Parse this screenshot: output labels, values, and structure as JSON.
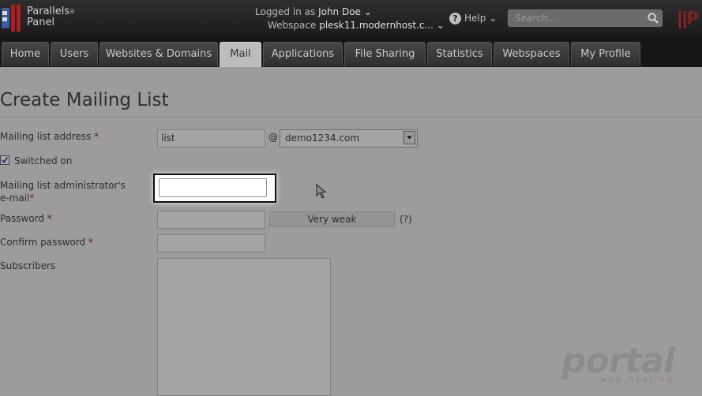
{
  "header": {
    "logo_line1": "Parallels",
    "logo_line2": "Panel",
    "logo_reg": "®",
    "logged_in_prefix": "Logged in as",
    "user_name": "John Doe",
    "webspace_prefix": "Webspace",
    "webspace_name": "plesk11.modernhost.c...",
    "help_label": "Help",
    "search_placeholder": "Search...",
    "brand_right": "P"
  },
  "nav": {
    "tabs": [
      {
        "label": "Home"
      },
      {
        "label": "Users"
      },
      {
        "label": "Websites & Domains"
      },
      {
        "label": "Mail"
      },
      {
        "label": "Applications"
      },
      {
        "label": "File Sharing"
      },
      {
        "label": "Statistics"
      },
      {
        "label": "Webspaces"
      },
      {
        "label": "My Profile"
      }
    ],
    "active": "Mail"
  },
  "page": {
    "title": "Create Mailing List"
  },
  "form": {
    "address_label": "Mailing list address",
    "address_value": "list",
    "at_sign": "@",
    "domain_value": "demo1234.com",
    "switched_on_label": "Switched on",
    "switched_on_checked": true,
    "admin_label_line1": "Mailing list administrator's",
    "admin_label_line2": "e-mail",
    "admin_value": "",
    "password_label": "Password",
    "strength_text": "Very weak",
    "help_mark": "(?)",
    "confirm_label": "Confirm password",
    "subscribers_label": "Subscribers",
    "required_mark": "*"
  },
  "watermark": {
    "brand": "portal",
    "sub": "web hosting"
  },
  "colors": {
    "topbar": "#1f1f1f",
    "required": "#7a1515",
    "highlight_border": "#0f0f0f"
  }
}
